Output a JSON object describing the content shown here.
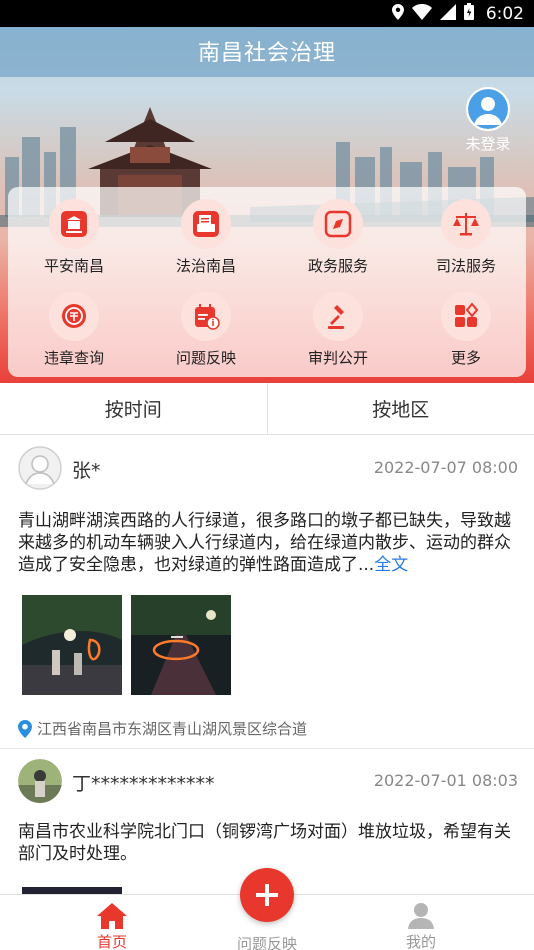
{
  "status_bar": {
    "time": "6:02"
  },
  "header": {
    "title": "南昌社会治理",
    "login_label": "未登录"
  },
  "grid": [
    {
      "label": "平安南昌",
      "icon": "building-icon"
    },
    {
      "label": "法治南昌",
      "icon": "printer-icon"
    },
    {
      "label": "政务服务",
      "icon": "compass-icon"
    },
    {
      "label": "司法服务",
      "icon": "scales-icon"
    },
    {
      "label": "违章查询",
      "icon": "violation-icon"
    },
    {
      "label": "问题反映",
      "icon": "calendar-info-icon"
    },
    {
      "label": "审判公开",
      "icon": "gavel-icon"
    },
    {
      "label": "更多",
      "icon": "more-icon"
    }
  ],
  "tabs": [
    "按时间",
    "按地区"
  ],
  "posts": [
    {
      "user": "张*",
      "time": "2022-07-07 08:00",
      "text": "青山湖畔湖滨西路的人行绿道，很多路口的墩子都已缺失，导致越来越多的机动车辆驶入人行绿道内，给在绿道内散步、运动的群众造成了安全隐患，也对绿道的弹性路面造成了...",
      "more": "全文",
      "location": "江西省南昌市东湖区青山湖风景区综合道"
    },
    {
      "user": "丁*************",
      "time": "2022-07-01 08:03",
      "text": "南昌市农业科学院北门口（铜锣湾广场对面）堆放垃圾，希望有关部门及时处理。"
    }
  ],
  "bottom_nav": {
    "home": "首页",
    "report": "问题反映",
    "mine": "我的"
  },
  "colors": {
    "accent": "#e8372d",
    "link": "#2a7be4"
  }
}
